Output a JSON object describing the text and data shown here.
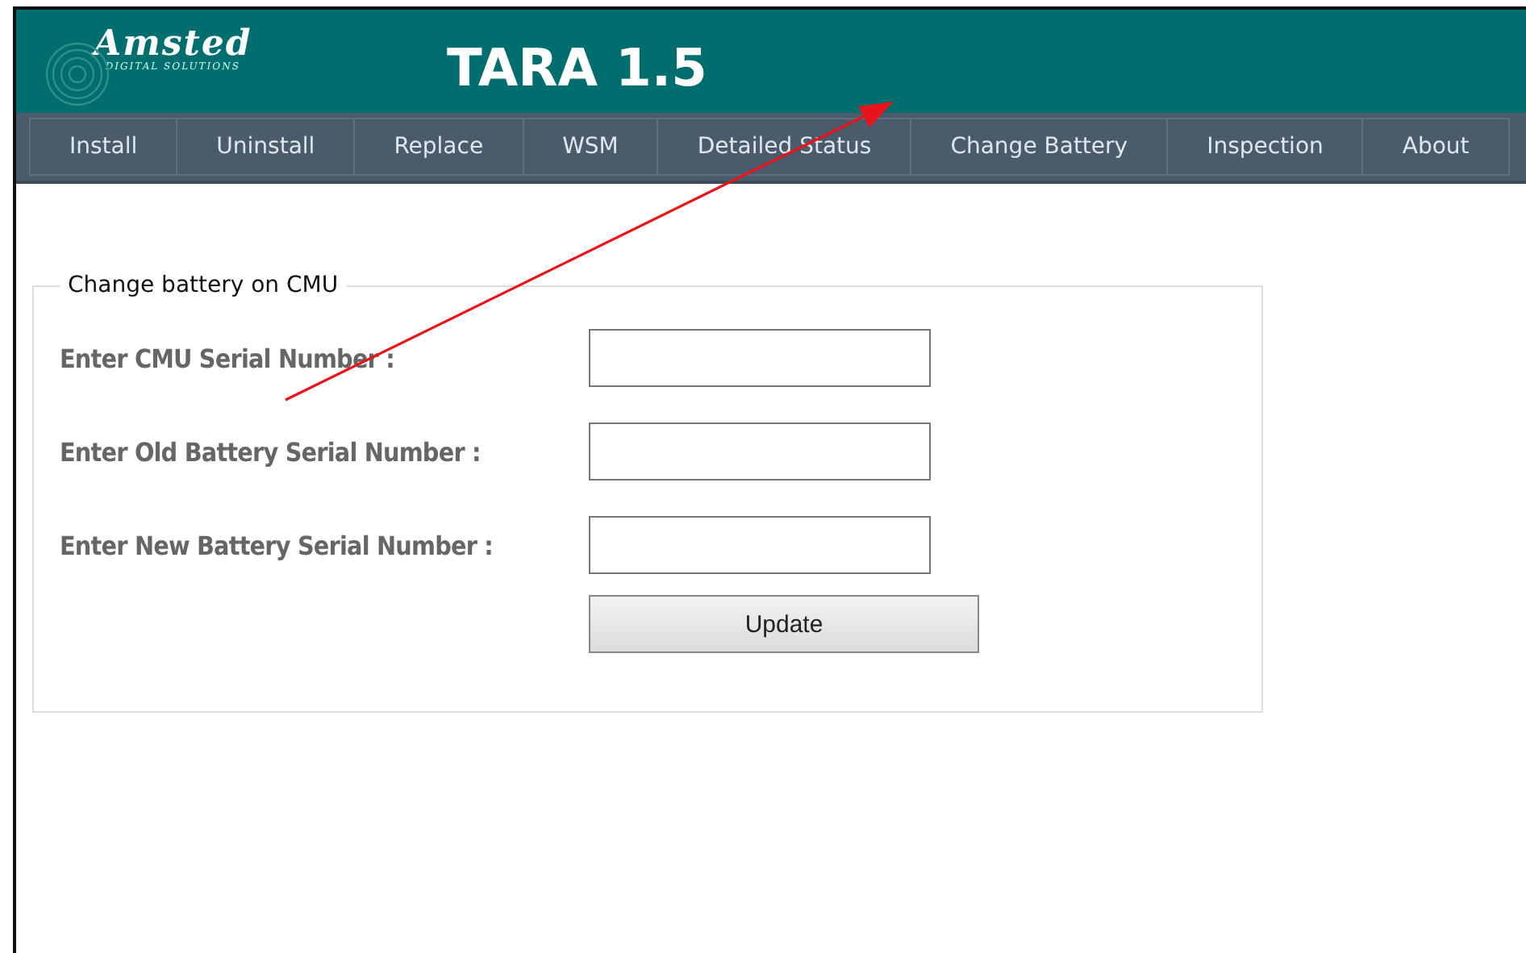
{
  "header": {
    "logo": {
      "name": "Amsted",
      "tagline": "DIGITAL SOLUTIONS"
    },
    "title": "TARA 1.5"
  },
  "tabs": [
    {
      "label": "Install",
      "selected": false
    },
    {
      "label": "Uninstall",
      "selected": false
    },
    {
      "label": "Replace",
      "selected": false
    },
    {
      "label": "WSM",
      "selected": false
    },
    {
      "label": "Detailed Status",
      "selected": false
    },
    {
      "label": "Change Battery",
      "selected": false
    },
    {
      "label": "Inspection",
      "selected": false
    },
    {
      "label": "About",
      "selected": false
    }
  ],
  "form": {
    "legend": "Change battery on CMU",
    "fields": [
      {
        "label": "Enter CMU Serial Number :"
      },
      {
        "label": "Enter Old Battery Serial Number :"
      },
      {
        "label": "Enter New Battery Serial Number :"
      }
    ],
    "button": "Update"
  },
  "annotation": {
    "kind": "arrow"
  }
}
